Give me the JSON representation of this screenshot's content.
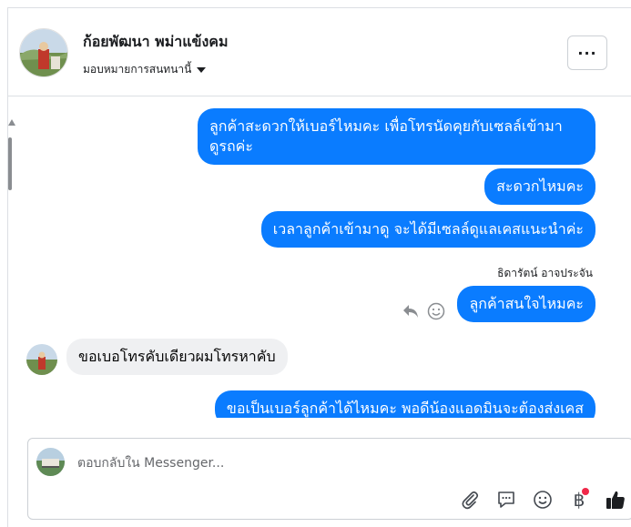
{
  "header": {
    "name": "ก้อยพัฒนา พม่าแข้งคม",
    "subtitle": "มอบหมายการสนทนานี้",
    "more_label": "···"
  },
  "messages": [
    {
      "id": "m1",
      "direction": "outgoing",
      "lines": [
        "ลูกค้าสะดวกให้เบอร์ไหมคะ เพื่อโทรนัดคุยกับเซลล์เข้ามา",
        "ดูรถค่ะ"
      ]
    },
    {
      "id": "m2",
      "direction": "outgoing",
      "text": "สะดวกไหมคะ"
    },
    {
      "id": "m3",
      "direction": "outgoing",
      "text": "เวลาลูกค้าเข้ามาดู จะได้มีเซลล์ดูแลเคสแนะนำค่ะ"
    },
    {
      "id": "sender",
      "text": "ธิดารัตน์ อาจประจัน"
    },
    {
      "id": "m4",
      "direction": "outgoing",
      "text": "ลูกค้าสนใจไหมคะ"
    },
    {
      "id": "m5",
      "direction": "incoming",
      "text": "ขอเบอโทรคับเดียวผมโทรหาคับ"
    },
    {
      "id": "m6",
      "direction": "outgoing",
      "text": "ขอเป็นเบอร์ลูกค้าได้ไหมคะ พอดีน้องแอดมินจะต้องส่งเคส"
    }
  ],
  "composer": {
    "placeholder": "ตอบกลับใน Messenger...",
    "tools": [
      "attach-icon",
      "speech-bubble-icon",
      "emoji-icon",
      "baht-icon",
      "thumbs-up-icon"
    ],
    "baht_symbol": "฿"
  },
  "colors": {
    "outgoing_bubble": "#0a7cff",
    "incoming_bubble": "#eff0f2",
    "notification_dot": "#f02849"
  }
}
